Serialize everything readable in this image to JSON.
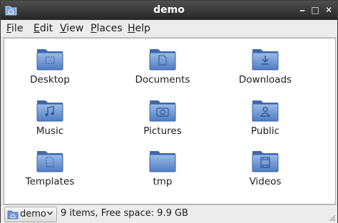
{
  "window": {
    "title": "demo"
  },
  "menu": [
    {
      "key": "F",
      "rest": "ile"
    },
    {
      "key": "E",
      "rest": "dit"
    },
    {
      "key": "V",
      "rest": "iew"
    },
    {
      "key": "P",
      "rest": "laces"
    },
    {
      "key": "H",
      "rest": "elp"
    }
  ],
  "items": [
    {
      "label": "Desktop",
      "icon": "desktop-folder-icon"
    },
    {
      "label": "Documents",
      "icon": "documents-folder-icon"
    },
    {
      "label": "Downloads",
      "icon": "downloads-folder-icon"
    },
    {
      "label": "Music",
      "icon": "music-folder-icon"
    },
    {
      "label": "Pictures",
      "icon": "pictures-folder-icon"
    },
    {
      "label": "Public",
      "icon": "public-folder-icon"
    },
    {
      "label": "Templates",
      "icon": "templates-folder-icon"
    },
    {
      "label": "tmp",
      "icon": "folder-icon"
    },
    {
      "label": "Videos",
      "icon": "videos-folder-icon"
    }
  ],
  "status": {
    "location": "demo",
    "text": "9 items, Free space: 9.9 GB"
  },
  "colors": {
    "folder_blue": "#5a85c8",
    "title_bar": "#2e2e2e"
  }
}
